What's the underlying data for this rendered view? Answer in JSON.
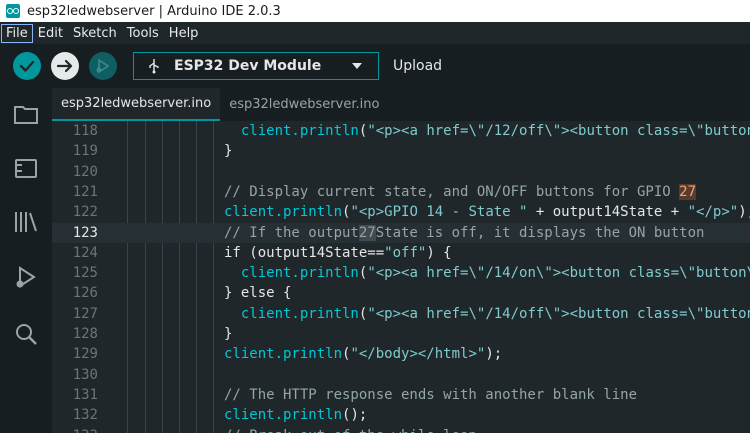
{
  "window": {
    "title": "esp32ledwebserver | Arduino IDE 2.0.3"
  },
  "menu": [
    "File",
    "Edit",
    "Sketch",
    "Tools",
    "Help"
  ],
  "toolbar": {
    "verify_icon": "check-icon",
    "upload_icon": "arrow-right-icon",
    "debug_icon": "debug-icon",
    "board": "ESP32 Dev Module",
    "upload_label": "Upload"
  },
  "sidebar": [
    "folder-icon",
    "board-manager-icon",
    "library-icon",
    "debug-icon",
    "search-icon"
  ],
  "tabs": [
    {
      "label": "esp32ledwebserver.ino",
      "active": true
    },
    {
      "label": "esp32ledwebserver.ino",
      "active": false
    }
  ],
  "editor": {
    "current_line": 123,
    "lines": [
      {
        "n": "118",
        "code": "  client.println(\"<p><a href=\\\"/12/off\\\"><button class=\\\"button"
      },
      {
        "n": "119",
        "code": "}"
      },
      {
        "n": "120",
        "code": ""
      },
      {
        "n": "121",
        "code": "// Display current state, and ON/OFF buttons for GPIO 27"
      },
      {
        "n": "122",
        "code": "client.println(\"<p>GPIO 14 - State \" + output14State + \"</p>\");"
      },
      {
        "n": "123",
        "code": "// If the output27State is off, it displays the ON button"
      },
      {
        "n": "124",
        "code": "if (output14State==\"off\") {"
      },
      {
        "n": "125",
        "code": "  client.println(\"<p><a href=\\\"/14/on\\\"><button class=\\\"button\\\""
      },
      {
        "n": "126",
        "code": "} else {"
      },
      {
        "n": "127",
        "code": "  client.println(\"<p><a href=\\\"/14/off\\\"><button class=\\\"button"
      },
      {
        "n": "128",
        "code": "}"
      },
      {
        "n": "129",
        "code": "client.println(\"</body></html>\");"
      },
      {
        "n": "130",
        "code": ""
      },
      {
        "n": "131",
        "code": "// The HTTP response ends with another blank line"
      },
      {
        "n": "132",
        "code": "client.println();"
      },
      {
        "n": "133",
        "code": "// Break out of the while loop"
      }
    ]
  }
}
